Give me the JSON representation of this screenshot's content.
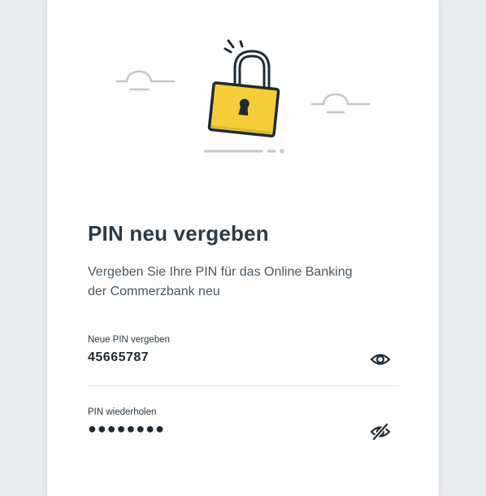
{
  "page": {
    "title": "PIN neu vergeben",
    "subtitle_line1": "Vergeben Sie Ihre PIN für das Online Banking",
    "subtitle_line2": "der Commerzbank neu"
  },
  "fields": [
    {
      "label": "Neue PIN vergeben",
      "value": "45665787",
      "visibility_icon": "eye-icon"
    },
    {
      "label": "PIN wiederholen",
      "value": "●●●●●●●●",
      "visibility_icon": "eye-off-icon"
    }
  ],
  "illustration": {
    "icon": "unlocked-padlock-icon",
    "colors": {
      "lock": "#f5cd3a",
      "outline": "#1f2b33",
      "cloud": "#c3c8cc"
    }
  }
}
